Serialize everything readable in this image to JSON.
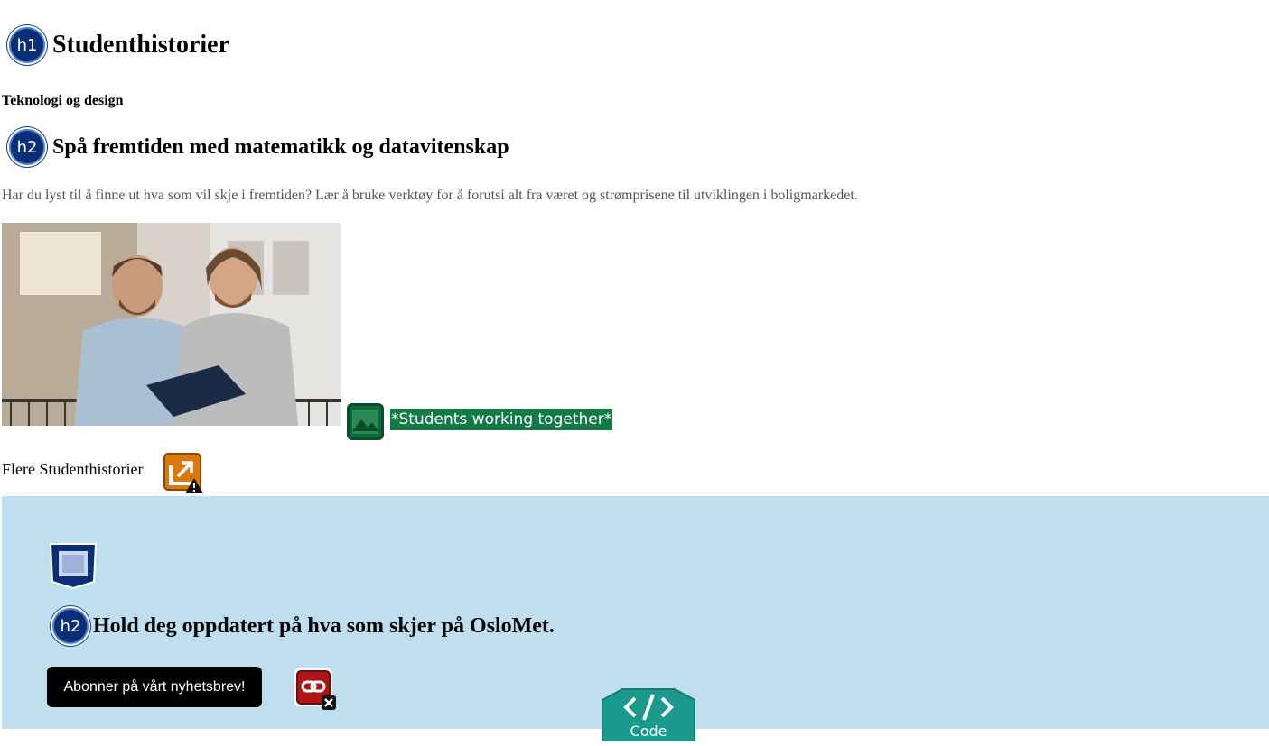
{
  "header": {
    "h1_badge": "h1",
    "title": "Studenthistorier"
  },
  "article": {
    "category": "Teknologi og design",
    "h2_badge": "h2",
    "heading": "Spå fremtiden med matematikk og datavitenskap",
    "lead": "Har du lyst til å finne ut hva som vil skje i fremtiden? Lær å bruke verktøy for å forutsi alt fra været og strømprisene til utviklingen i boligmarkedet.",
    "image_alt": "*Students working together*",
    "more_link": "Flere Studenthistorier"
  },
  "newsletter": {
    "h2_badge": "h2",
    "heading": "Hold deg oppdatert på hva som skjer på OsloMet.",
    "button_label": "Abonner på vårt nyhetsbrev!",
    "code_badge": "Code"
  },
  "colors": {
    "badge": "#0b2f77",
    "image_alert": "#137a45",
    "newsletter_bg": "#bfdff0",
    "link_warning": "#d9780c",
    "broken_link": "#b01515",
    "code_badge": "#1a9a8c"
  },
  "icons": [
    "h1-badge-icon",
    "h2-badge-icon",
    "image-icon",
    "external-link-warning-icon",
    "section-icon",
    "broken-link-icon",
    "code-icon"
  ]
}
